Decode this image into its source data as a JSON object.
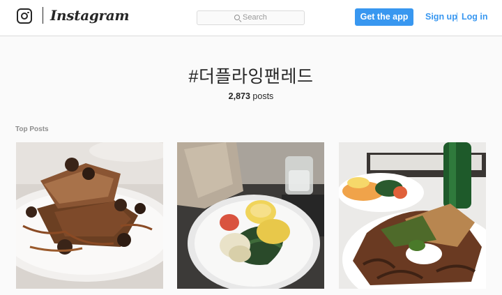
{
  "header": {
    "brand": "Instagram",
    "search_placeholder": "Search",
    "get_app_label": "Get the app",
    "sign_up_label": "Sign up",
    "separator": "|",
    "log_in_label": "Log in"
  },
  "hashtag": {
    "title": "#더플라잉팬레드",
    "post_count": "2,873",
    "post_count_suffix": " posts"
  },
  "top_posts": {
    "label": "Top Posts"
  }
}
